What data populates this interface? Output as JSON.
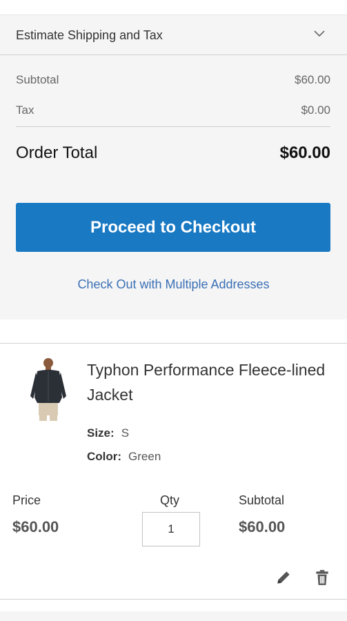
{
  "summary": {
    "shipping_toggle_label": "Estimate Shipping and Tax",
    "subtotal_label": "Subtotal",
    "subtotal_value": "$60.00",
    "tax_label": "Tax",
    "tax_value": "$0.00",
    "order_total_label": "Order Total",
    "order_total_value": "$60.00",
    "checkout_button_label": "Proceed to Checkout",
    "multi_address_link": "Check Out with Multiple Addresses"
  },
  "cart_item": {
    "name": "Typhon Performance Fleece-lined Jacket",
    "options": [
      {
        "label": "Size:",
        "value": "S"
      },
      {
        "label": "Color:",
        "value": "Green"
      }
    ],
    "price_label": "Price",
    "price_value": "$60.00",
    "qty_label": "Qty",
    "qty_value": "1",
    "subtotal_label": "Subtotal",
    "subtotal_value": "$60.00",
    "icons": [
      "pencil-icon",
      "trash-icon"
    ]
  },
  "colors": {
    "accent": "#1979c3",
    "link": "#3a6fb5",
    "summary_bg": "#f5f5f5"
  }
}
